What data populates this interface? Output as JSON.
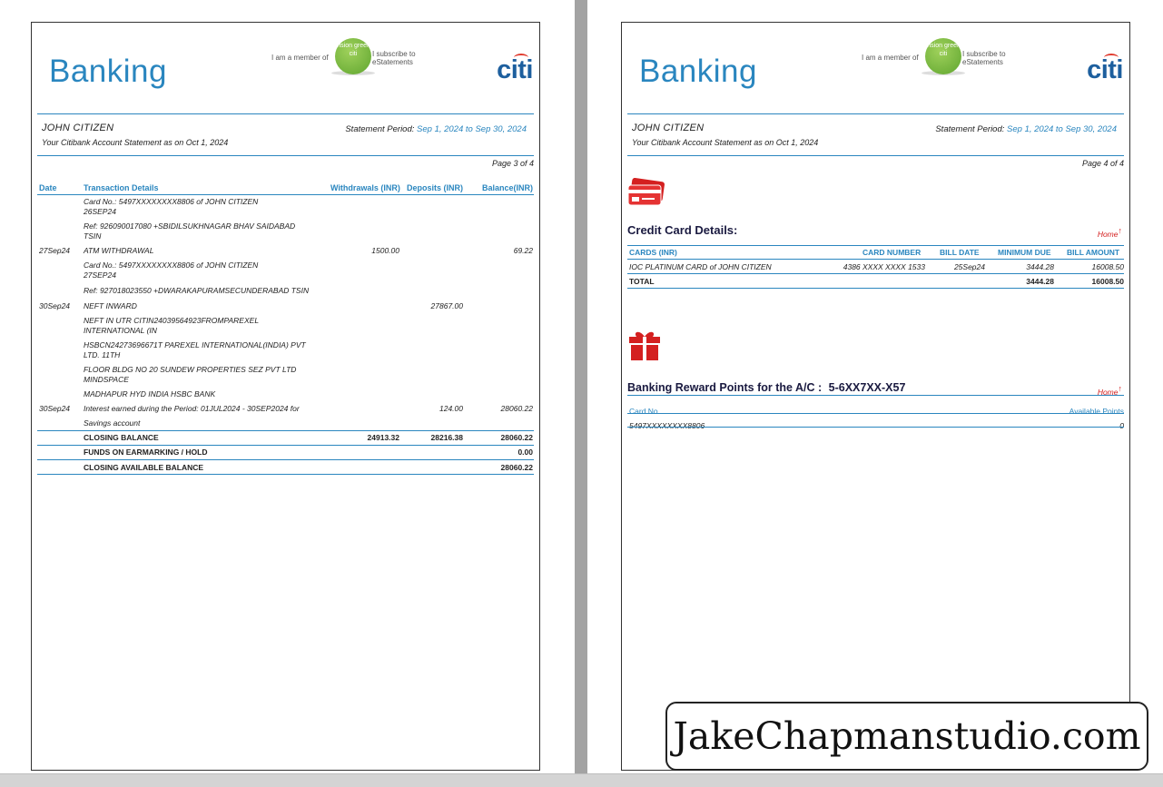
{
  "header": {
    "banking_title": "Banking",
    "member_prefix": "I am a member of",
    "vision_logo": "vision green citi",
    "member_suffix": "I subscribe to eStatements",
    "brand": "citi",
    "customer_name": "JOHN CITIZEN",
    "statement_as_on": "Your Citibank Account Statement as on Oct 1, 2024",
    "period_label": "Statement Period:",
    "period_value": "Sep 1, 2024 to Sep 30, 2024"
  },
  "left_page": {
    "page_label": "Page 3 of 4",
    "columns": [
      "Date",
      "Transaction Details",
      "Withdrawals (INR)",
      "Deposits (INR)",
      "Balance(INR)"
    ],
    "rows": [
      {
        "date": "",
        "details": "Card No.: 5497XXXXXXXX8806 of JOHN CITIZEN",
        "details2": "26SEP24",
        "withdrawal": "",
        "deposit": "",
        "balance": ""
      },
      {
        "date": "",
        "details": "Ref: 926090017080 +SBIDILSUKHNAGAR BHAV SAIDABAD",
        "details2": "TSIN",
        "withdrawal": "",
        "deposit": "",
        "balance": ""
      },
      {
        "date": "27Sep24",
        "details": "ATM WITHDRAWAL",
        "details2": "",
        "withdrawal": "1500.00",
        "deposit": "",
        "balance": "69.22"
      },
      {
        "date": "",
        "details": "Card No.: 5497XXXXXXXX8806 of JOHN CITIZEN",
        "details2": "27SEP24",
        "withdrawal": "",
        "deposit": "",
        "balance": ""
      },
      {
        "date": "",
        "details": "Ref: 927018023550 +DWARAKAPURAMSECUNDERABAD TSIN",
        "details2": "",
        "withdrawal": "",
        "deposit": "",
        "balance": ""
      },
      {
        "date": "30Sep24",
        "details": "NEFT INWARD",
        "details2": "",
        "withdrawal": "",
        "deposit": "27867.00",
        "balance": ""
      },
      {
        "date": "",
        "details": "NEFT IN UTR CITIN24039564923FROMPAREXEL",
        "details2": "INTERNATIONAL (IN",
        "withdrawal": "",
        "deposit": "",
        "balance": ""
      },
      {
        "date": "",
        "details": "HSBCN24273696671T PAREXEL INTERNATIONAL(INDIA) PVT",
        "details2": "LTD. 11TH",
        "withdrawal": "",
        "deposit": "",
        "balance": ""
      },
      {
        "date": "",
        "details": "FLOOR BLDG NO 20 SUNDEW PROPERTIES SEZ PVT LTD",
        "details2": "MINDSPACE",
        "withdrawal": "",
        "deposit": "",
        "balance": ""
      },
      {
        "date": "",
        "details": "MADHAPUR HYD INDIA HSBC BANK",
        "details2": "",
        "withdrawal": "",
        "deposit": "",
        "balance": ""
      },
      {
        "date": "30Sep24",
        "details": "Interest earned during the Period: 01JUL2024 - 30SEP2024 for",
        "details2": "",
        "withdrawal": "",
        "deposit": "124.00",
        "balance": "28060.22"
      },
      {
        "date": "",
        "details": "Savings account",
        "details2": "",
        "withdrawal": "",
        "deposit": "",
        "balance": ""
      }
    ],
    "closing_balance": {
      "label": "CLOSING BALANCE",
      "withdrawals": "24913.32",
      "deposits": "28216.38",
      "balance": "28060.22"
    },
    "funds_on_hold": {
      "label": "FUNDS ON EARMARKING / HOLD",
      "balance": "0.00"
    },
    "closing_available": {
      "label": "CLOSING AVAILABLE BALANCE",
      "balance": "28060.22"
    }
  },
  "right_page": {
    "page_label": "Page 4 of 4",
    "credit_card_title": "Credit Card Details:",
    "home_link": "Home",
    "cc_columns": [
      "CARDS (INR)",
      "CARD NUMBER",
      "BILL DATE",
      "MINIMUM DUE",
      "BILL AMOUNT"
    ],
    "cc_row": {
      "card": "IOC PLATINUM CARD   of JOHN CITIZEN",
      "number": "4386 XXXX XXXX 1533",
      "bill_date": "25Sep24",
      "minimum_due": "3444.28",
      "bill_amount": "16008.50"
    },
    "cc_total": {
      "label": "TOTAL",
      "minimum_due": "3444.28",
      "bill_amount": "16008.50"
    },
    "rewards_title": "Banking Reward Points for the A/C :",
    "rewards_account": "5-6XX7XX-X57",
    "rewards_columns": [
      "Card No",
      "Available Points"
    ],
    "rewards_row": {
      "card_no": "5497XXXXXXXX8806",
      "points": "0"
    }
  },
  "watermark": "JakeChapmanstudio.com",
  "colors": {
    "accent": "#2a86bf",
    "brand": "#1d5f9e",
    "icon_red": "#d42020",
    "vision_green": "#6db33f"
  },
  "icons": [
    "credit-card-icon",
    "gift-icon",
    "home-arrow-icon"
  ]
}
